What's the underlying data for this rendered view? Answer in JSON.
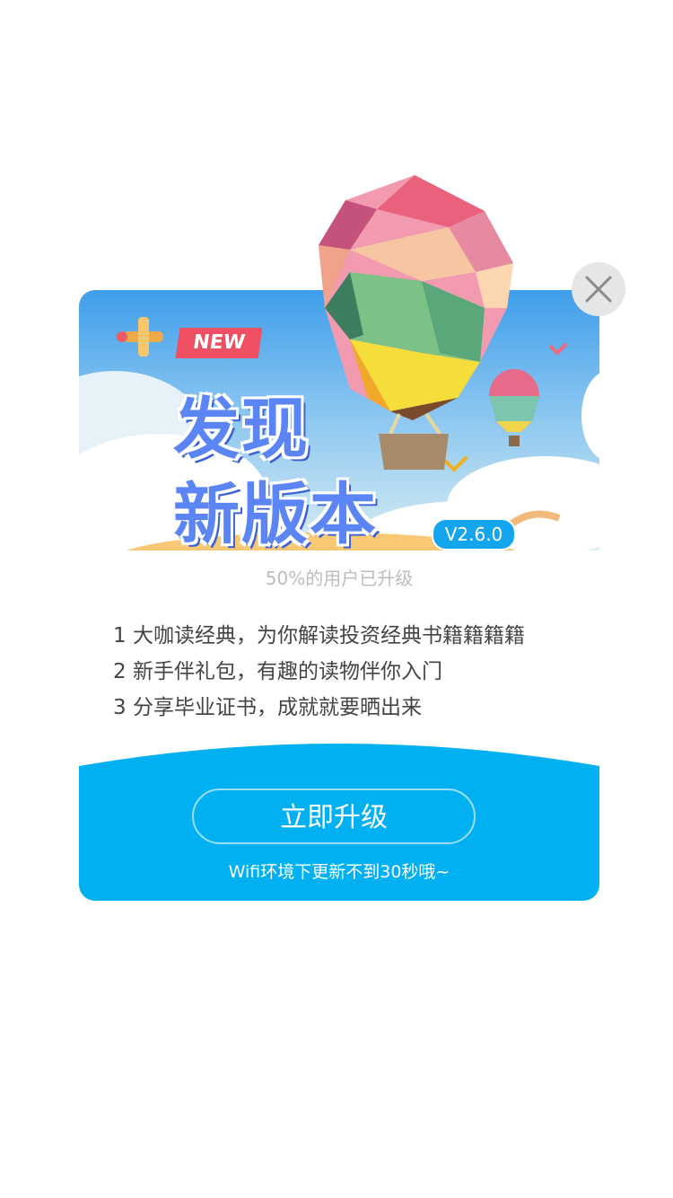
{
  "banner": {
    "new_tag": "NEW",
    "headline_line1": "发现",
    "headline_line2": "新版本",
    "version": "V2.6.0"
  },
  "upgrade_percent_text": "50%的用户已升级",
  "features": [
    "1 大咖读经典，为你解读投资经典书籍籍籍籍",
    "2 新手伴礼包，有趣的读物伴你入门",
    "3 分享毕业证书，成就就要晒出来"
  ],
  "actions": {
    "upgrade_label": "立即升级",
    "wifi_note": "Wifi环境下更新不到30秒哦~"
  },
  "icons": {
    "close": "close-icon",
    "airplane": "airplane-icon",
    "balloon": "hot-air-balloon-illustration"
  },
  "colors": {
    "accent": "#00b0f0",
    "headline": "#5b85f5",
    "new_tag": "#ef4f62"
  }
}
